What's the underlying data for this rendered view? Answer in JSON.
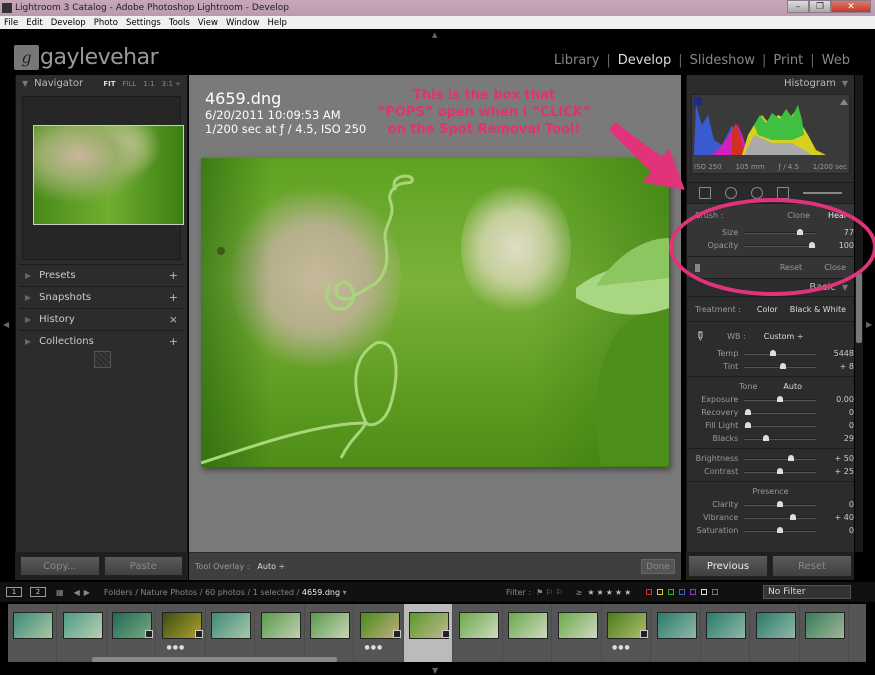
{
  "window": {
    "title": "Lightroom 3 Catalog - Adobe Photoshop Lightroom - Develop",
    "minimize": "–",
    "maximize": "❐",
    "close": "✕"
  },
  "menu": [
    "File",
    "Edit",
    "Develop",
    "Photo",
    "Settings",
    "Tools",
    "View",
    "Window",
    "Help"
  ],
  "identity": {
    "logo_letter": "g",
    "logo_text": "gaylevehar"
  },
  "modules": {
    "items": [
      "Library",
      "Develop",
      "Slideshow",
      "Print",
      "Web"
    ],
    "active": "Develop",
    "separator": "|"
  },
  "left": {
    "navigator": {
      "title": "Navigator",
      "options": [
        "FIT",
        "FILL",
        "1:1",
        "3:1 ÷"
      ],
      "active": "FIT"
    },
    "panels": [
      {
        "label": "Presets",
        "action": "+"
      },
      {
        "label": "Snapshots",
        "action": "+"
      },
      {
        "label": "History",
        "action": "×"
      },
      {
        "label": "Collections",
        "action": "+"
      }
    ],
    "copy_label": "Copy...",
    "paste_label": "Paste"
  },
  "image": {
    "filename": "4659.dng",
    "datetime": "6/20/2011 10:09:53 AM",
    "exposure": "1/200 sec at ƒ / 4.5, ISO 250"
  },
  "annotation": {
    "lines": [
      "This is the box that",
      "“POPS” open when I “CLICK”",
      "on the Spot Removal Tool!"
    ],
    "color": "#e0336f"
  },
  "toolbar": {
    "overlay_label": "Tool Overlay :",
    "overlay_value": "Auto ÷",
    "done_label": "Done"
  },
  "right": {
    "histogram": {
      "title": "Histogram",
      "iso": "ISO 250",
      "focal": "105 mm",
      "aperture": "ƒ / 4.5",
      "shutter": "1/200 sec"
    },
    "spot": {
      "brush_label": "Brush :",
      "clone_label": "Clone",
      "heal_label": "Heal",
      "sliders": [
        {
          "label": "Size",
          "value": "77",
          "fraction": 0.78
        },
        {
          "label": "Opacity",
          "value": "100",
          "fraction": 0.95
        }
      ],
      "reset_label": "Reset",
      "close_label": "Close"
    },
    "basic": {
      "title": "Basic",
      "treatment_label": "Treatment :",
      "treatment_options": [
        "Color",
        "Black & White"
      ],
      "wb_label": "WB :",
      "wb_value": "Custom ÷",
      "wb_sliders": [
        {
          "label": "Temp",
          "value": "5448",
          "fraction": 0.4
        },
        {
          "label": "Tint",
          "value": "+ 8",
          "fraction": 0.55
        }
      ],
      "tone_label": "Tone",
      "auto_label": "Auto",
      "tone_sliders": [
        {
          "label": "Exposure",
          "value": "0.00",
          "fraction": 0.5
        },
        {
          "label": "Recovery",
          "value": "0",
          "fraction": 0.05
        },
        {
          "label": "Fill Light",
          "value": "0",
          "fraction": 0.05
        },
        {
          "label": "Blacks",
          "value": "29",
          "fraction": 0.3
        }
      ],
      "bc_sliders": [
        {
          "label": "Brightness",
          "value": "+ 50",
          "fraction": 0.65
        },
        {
          "label": "Contrast",
          "value": "+ 25",
          "fraction": 0.5
        }
      ],
      "presence_label": "Presence",
      "presence_sliders": [
        {
          "label": "Clarity",
          "value": "0",
          "fraction": 0.5
        },
        {
          "label": "Vibrance",
          "value": "+ 40",
          "fraction": 0.68
        },
        {
          "label": "Saturation",
          "value": "0",
          "fraction": 0.5
        }
      ]
    },
    "previous_label": "Previous",
    "reset_label": "Reset"
  },
  "filmstrip": {
    "screen1": "1",
    "screen2": "2",
    "path_prefix": "Folders / Nature Photos / 60 photos / 1 selected /",
    "path_file": "4659.dng",
    "filter_label": "Filter :",
    "rating_op": "≥",
    "stars": "★★★★★",
    "filter_value": "No Filter",
    "thumbs": [
      {
        "c1": "#3d8a7a",
        "c2": "#a8c8a0",
        "dots": false,
        "badge": false
      },
      {
        "c1": "#4f9a8a",
        "c2": "#b8d0b0",
        "dots": false,
        "badge": false
      },
      {
        "c1": "#1f6a5a",
        "c2": "#7aa880",
        "dots": false,
        "badge": true
      },
      {
        "c1": "#3a5010",
        "c2": "#b0a030",
        "dots": true,
        "badge": true
      },
      {
        "c1": "#3f8a7a",
        "c2": "#a8c8a8",
        "dots": false,
        "badge": false
      },
      {
        "c1": "#5a9a4a",
        "c2": "#c0d0b0",
        "dots": false,
        "badge": false
      },
      {
        "c1": "#5a9a4a",
        "c2": "#c8d4b8",
        "dots": false,
        "badge": false
      },
      {
        "c1": "#4a8a1a",
        "c2": "#c0b080",
        "dots": true,
        "badge": true
      },
      {
        "c1": "#5a9a2a",
        "c2": "#c0b890",
        "dots": false,
        "badge": true,
        "selected": true
      },
      {
        "c1": "#6aaa4a",
        "c2": "#d0d8c0",
        "dots": false,
        "badge": false
      },
      {
        "c1": "#6aaa4a",
        "c2": "#d0d8c0",
        "dots": false,
        "badge": false
      },
      {
        "c1": "#6aaa4a",
        "c2": "#d0d8c0",
        "dots": false,
        "badge": false
      },
      {
        "c1": "#4a7a1a",
        "c2": "#b0c070",
        "dots": true,
        "badge": true
      },
      {
        "c1": "#2a7a6a",
        "c2": "#90b8a8",
        "dots": false,
        "badge": false
      },
      {
        "c1": "#2a7a6a",
        "c2": "#90b8a8",
        "dots": false,
        "badge": false
      },
      {
        "c1": "#2a7a6a",
        "c2": "#90b8a8",
        "dots": false,
        "badge": false
      },
      {
        "c1": "#3a7a5a",
        "c2": "#a0b898",
        "dots": false,
        "badge": false
      }
    ]
  }
}
